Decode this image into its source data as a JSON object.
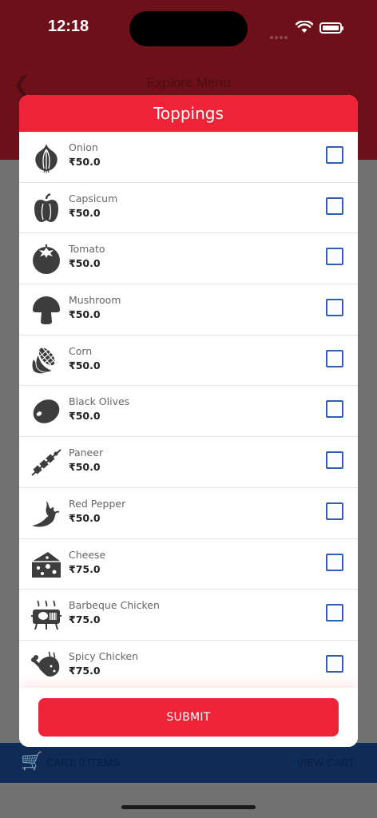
{
  "status": {
    "time": "12:18"
  },
  "background": {
    "title": "Explore Menu",
    "cart_text": "CART: 0 ITEMS",
    "view_cart": "VIEW CART"
  },
  "modal": {
    "title": "Toppings",
    "submit_label": "SUBMIT",
    "items": [
      {
        "name": "Onion",
        "price": "₹50.0",
        "icon": "onion-icon"
      },
      {
        "name": "Capsicum",
        "price": "₹50.0",
        "icon": "capsicum-icon"
      },
      {
        "name": "Tomato",
        "price": "₹50.0",
        "icon": "tomato-icon"
      },
      {
        "name": "Mushroom",
        "price": "₹50.0",
        "icon": "mushroom-icon"
      },
      {
        "name": "Corn",
        "price": "₹50.0",
        "icon": "corn-icon"
      },
      {
        "name": "Black Olives",
        "price": "₹50.0",
        "icon": "olive-icon"
      },
      {
        "name": "Paneer",
        "price": "₹50.0",
        "icon": "paneer-skewer-icon"
      },
      {
        "name": "Red Pepper",
        "price": "₹50.0",
        "icon": "chili-pepper-icon"
      },
      {
        "name": "Cheese",
        "price": "₹75.0",
        "icon": "cheese-icon"
      },
      {
        "name": "Barbeque Chicken",
        "price": "₹75.0",
        "icon": "bbq-grill-icon"
      },
      {
        "name": "Spicy Chicken",
        "price": "₹75.0",
        "icon": "chicken-leg-icon"
      }
    ]
  },
  "colors": {
    "accent": "#ef2338",
    "checkbox": "#2f5fb2",
    "icon": "#3d3d3d"
  }
}
